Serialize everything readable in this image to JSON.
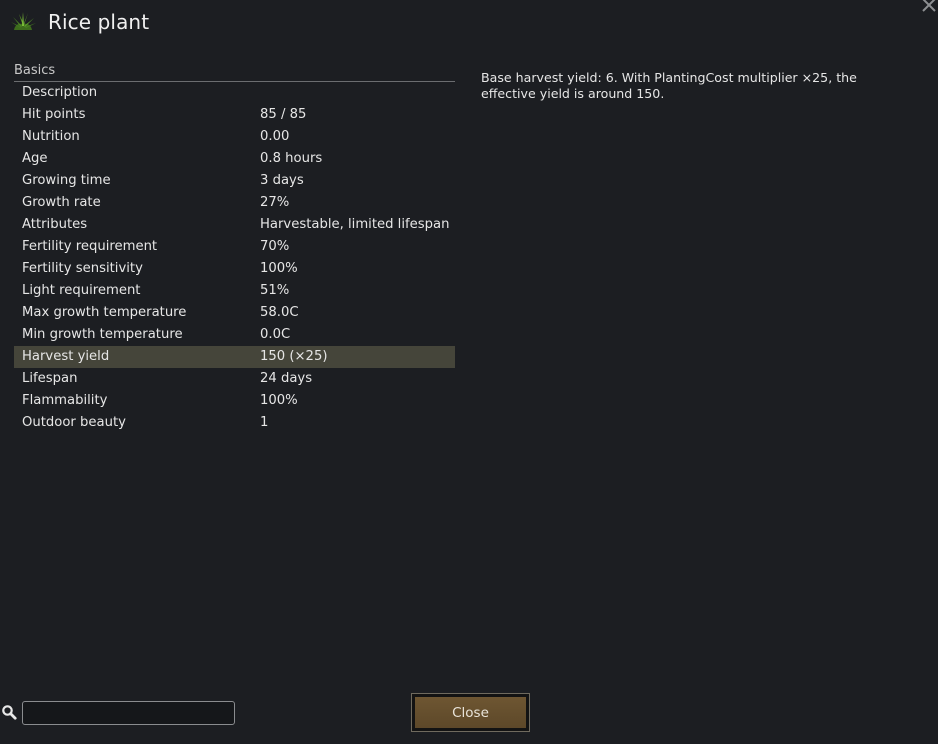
{
  "window": {
    "title": "Rice plant",
    "icon": "rice-plant-icon",
    "close_icon": "close-icon"
  },
  "basics": {
    "section_label": "Basics",
    "rows": [
      {
        "label": "Description",
        "value": ""
      },
      {
        "label": "Hit points",
        "value": "85 / 85"
      },
      {
        "label": "Nutrition",
        "value": "0.00"
      },
      {
        "label": "Age",
        "value": "0.8 hours"
      },
      {
        "label": "Growing time",
        "value": "3 days"
      },
      {
        "label": "Growth rate",
        "value": "27%"
      },
      {
        "label": "Attributes",
        "value": "Harvestable, limited lifespan"
      },
      {
        "label": "Fertility requirement",
        "value": "70%"
      },
      {
        "label": "Fertility sensitivity",
        "value": "100%"
      },
      {
        "label": "Light requirement",
        "value": "51%"
      },
      {
        "label": "Max growth temperature",
        "value": "58.0C"
      },
      {
        "label": "Min growth temperature",
        "value": "0.0C"
      },
      {
        "label": "Harvest yield",
        "value": "150 (×25)"
      },
      {
        "label": "Lifespan",
        "value": "24 days"
      },
      {
        "label": "Flammability",
        "value": "100%"
      },
      {
        "label": "Outdoor beauty",
        "value": "1"
      }
    ],
    "selected_row": "Harvest yield"
  },
  "description_panel": {
    "text": "Base harvest yield: 6. With PlantingCost multiplier ×25, the effective yield is around 150."
  },
  "footer": {
    "search_icon": "search-icon",
    "search_value": "",
    "close_label": "Close"
  },
  "colors": {
    "background": "#1c1e22",
    "selected_row": "#45453a",
    "button_fill": "#6e5632",
    "text": "#e6e6e6"
  }
}
